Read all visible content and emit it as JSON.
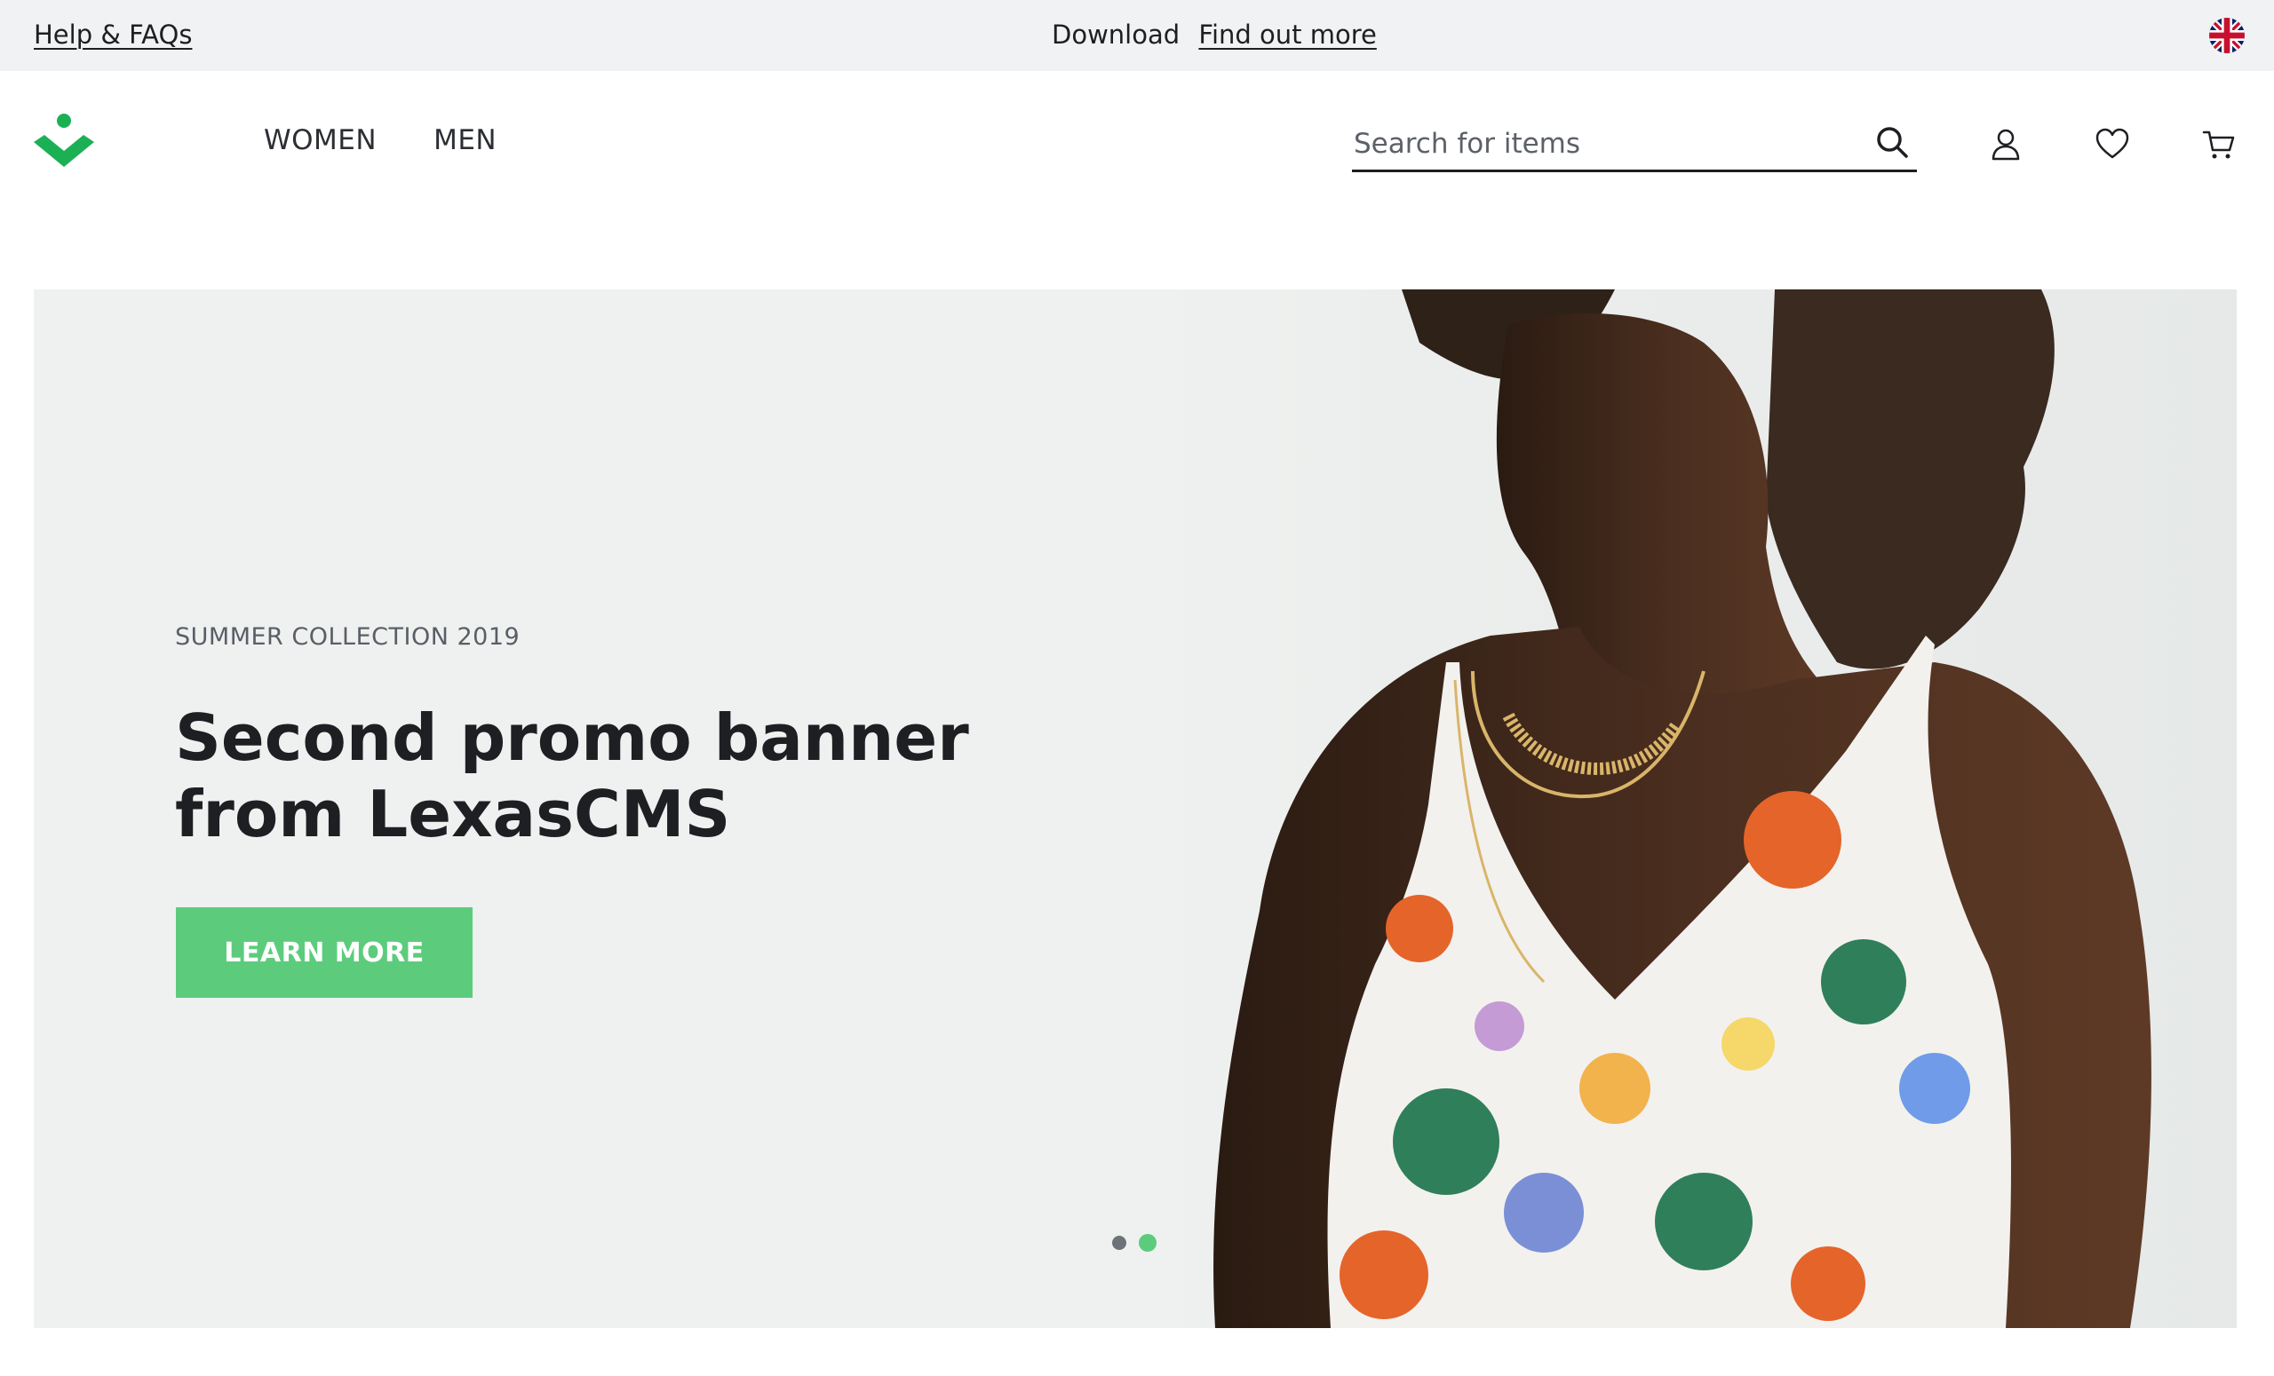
{
  "topbar": {
    "help_label": "Help & FAQs",
    "download_label": "Download",
    "find_out_more_label": "Find out more",
    "language_flag_icon": "uk-flag-icon"
  },
  "header": {
    "logo_icon": "brand-logo-icon",
    "nav": [
      {
        "label": "WOMEN"
      },
      {
        "label": "MEN"
      }
    ],
    "search": {
      "placeholder": "Search for items",
      "value": ""
    },
    "icons": [
      "user-icon",
      "heart-icon",
      "cart-icon"
    ]
  },
  "hero": {
    "eyebrow": "SUMMER COLLECTION 2019",
    "title": "Second promo banner from LexasCMS",
    "cta_label": "LEARN MORE",
    "slides_total": 2,
    "active_slide": 2
  },
  "colors": {
    "accent": "#5ccc7c",
    "topbar_bg": "#f1f2f3",
    "hero_bg": "#eff1f0",
    "text": "#1d1f22"
  }
}
